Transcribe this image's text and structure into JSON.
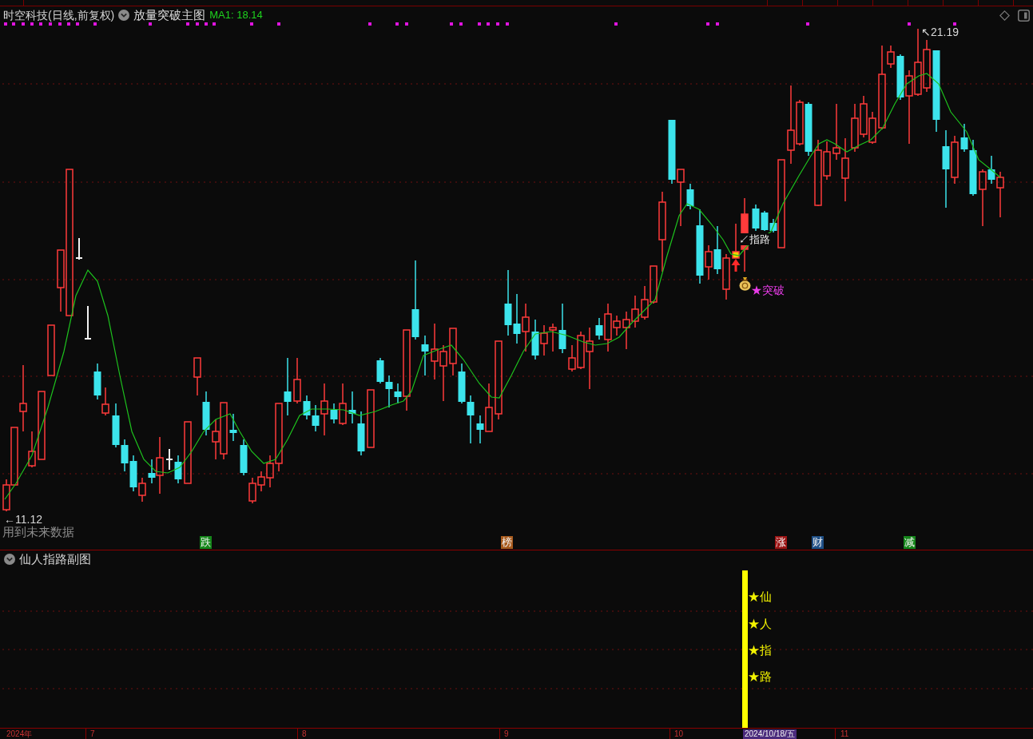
{
  "main_chart": {
    "title": "时空科技(日线,前复权)",
    "indicator": "放量突破主图",
    "ma_reading": "MA1: 18.14",
    "high_label": "↖21.19",
    "low_label": "←11.12",
    "note": "用到未来数据",
    "annotations": [
      {
        "kind": "pointer",
        "text": "↙指路"
      },
      {
        "kind": "breakout",
        "text": "★突破"
      }
    ],
    "tags": [
      {
        "label": "跌",
        "color": "#15861a"
      },
      {
        "label": "榜",
        "color": "#a85a1c"
      },
      {
        "label": "涨",
        "color": "#9c1414"
      },
      {
        "label": "财",
        "color": "#1f4f86"
      },
      {
        "label": "减",
        "color": "#15861a"
      }
    ]
  },
  "sub_chart": {
    "title": "仙人指路副图",
    "signal_labels": [
      "★仙",
      "★人",
      "★指",
      "★路"
    ]
  },
  "time_axis": {
    "labels": [
      {
        "text": "2024年",
        "selected": false
      },
      {
        "text": "7",
        "selected": false
      },
      {
        "text": "8",
        "selected": false
      },
      {
        "text": "9",
        "selected": false
      },
      {
        "text": "10",
        "selected": false
      },
      {
        "text": "2024/10/18/五",
        "selected": true
      },
      {
        "text": "11",
        "selected": false
      }
    ]
  }
}
